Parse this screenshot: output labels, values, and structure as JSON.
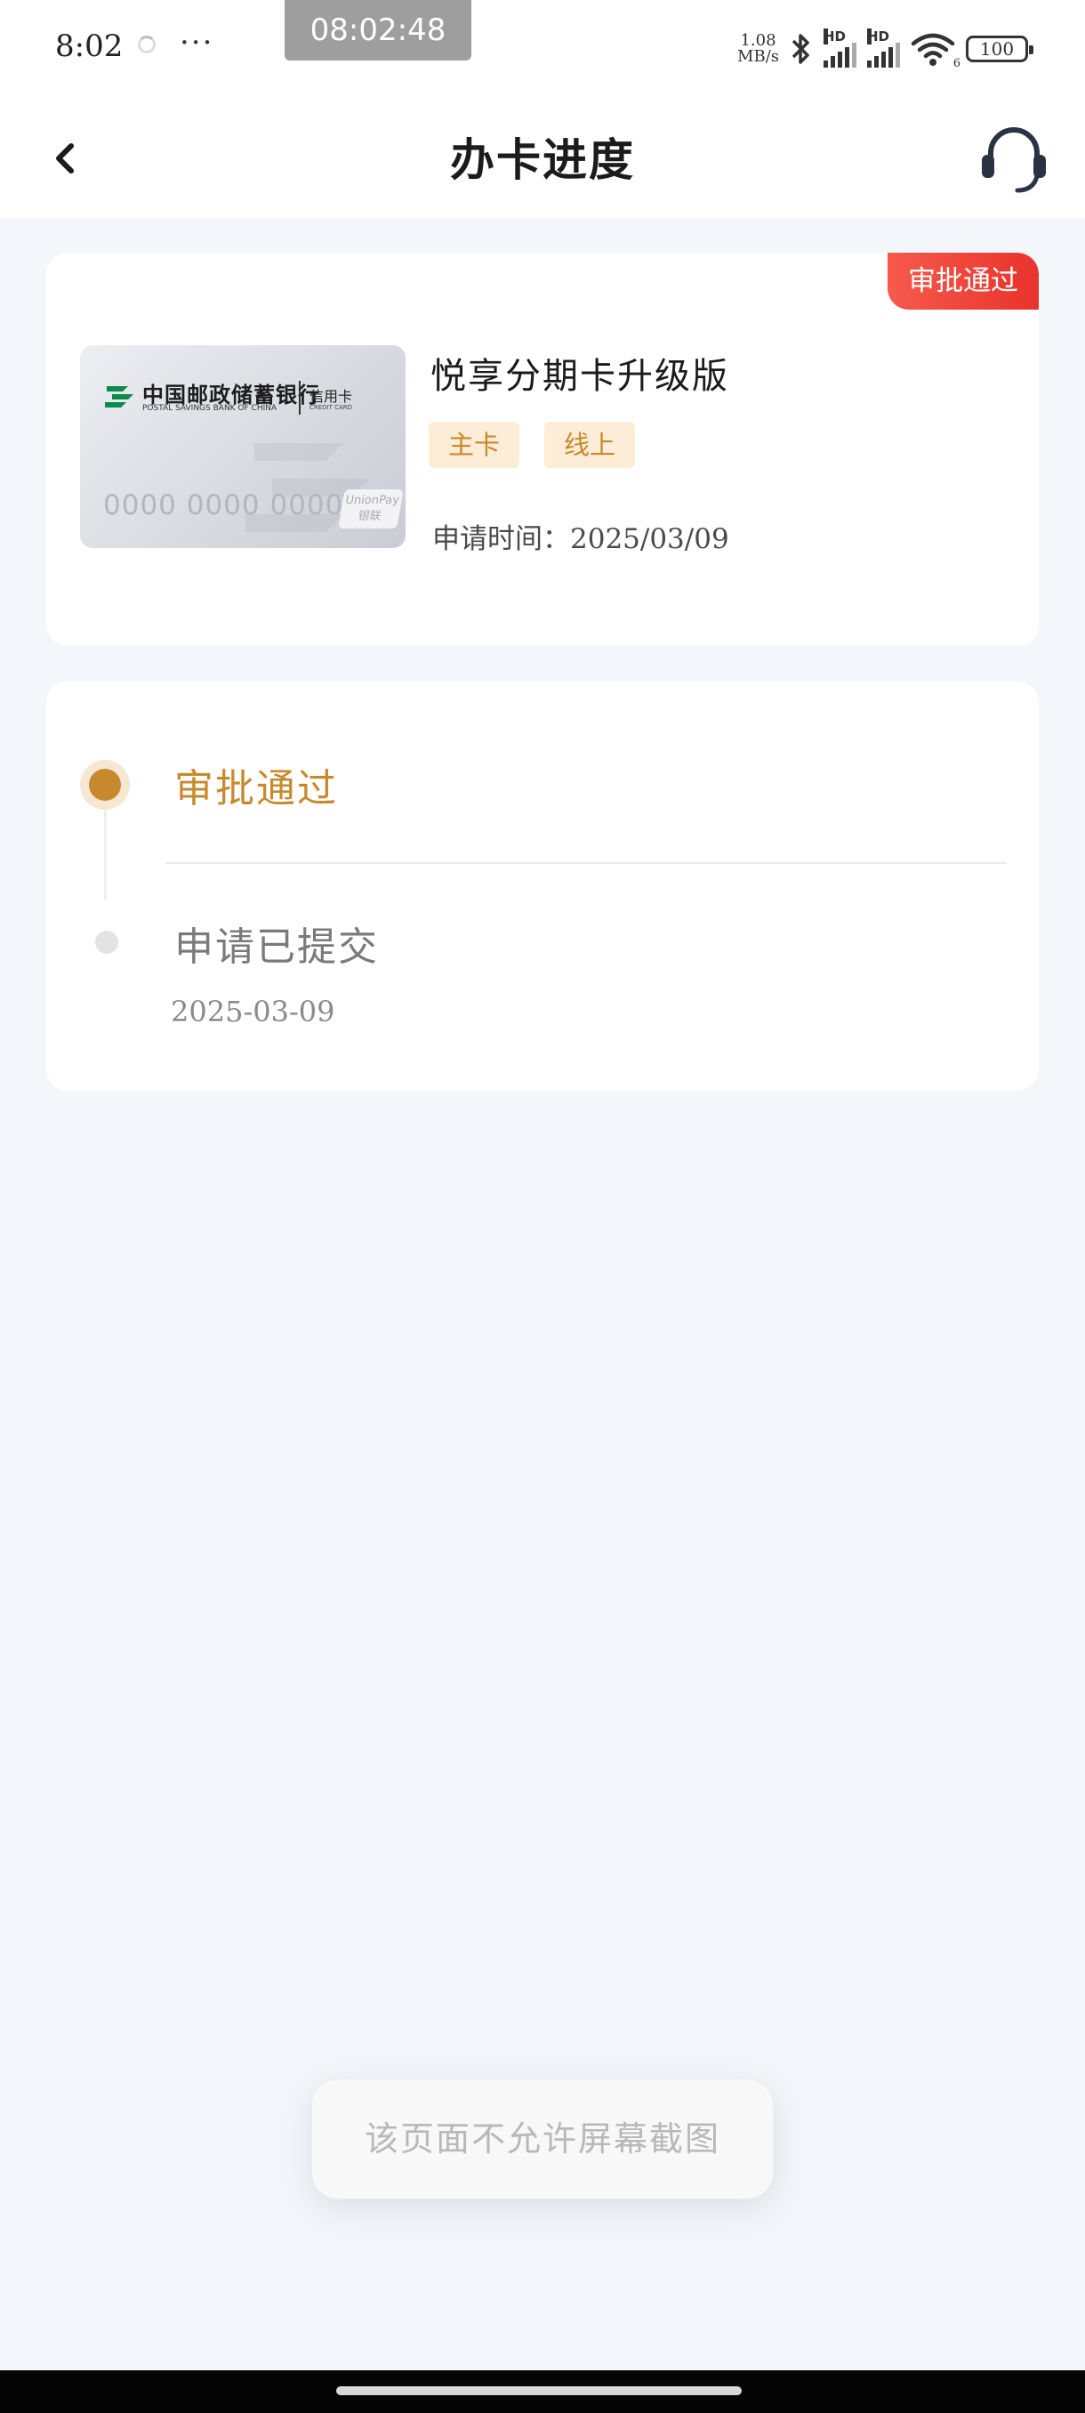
{
  "status_bar": {
    "time": "8:02",
    "more": "···",
    "clock_overlay": "08:02:48",
    "net_speed_value": "1.08",
    "net_speed_unit": "MB/s",
    "signal1_label": "HD",
    "signal2_label": "HD",
    "wifi_label": "6",
    "battery": "100"
  },
  "nav": {
    "title": "办卡进度"
  },
  "card": {
    "status_tag": "审批通过",
    "bank_name_cn": "中国邮政储蓄银行",
    "bank_name_en": "POSTAL SAVINGS BANK OF CHINA",
    "card_kind": "信用卡",
    "card_kind_en": "CREDIT CARD",
    "card_number": "0000 0000 0000",
    "union_pay_en": "UnionPay",
    "union_pay_cn": "银联",
    "product_name": "悦享分期卡升级版",
    "chips": [
      "主卡",
      "线上"
    ],
    "apply_time": "申请时间：2025/03/09"
  },
  "progress": {
    "steps": [
      {
        "title": "审批通过",
        "date": ""
      },
      {
        "title": "申请已提交",
        "date": "2025-03-09"
      }
    ]
  },
  "toast": {
    "message": "该页面不允许屏幕截图"
  },
  "colors": {
    "accent_gold": "#c8892e",
    "tag_red": "#e8332c",
    "chip_bg": "#fdecd6",
    "page_bg": "#f3f6fb"
  },
  "icons": {
    "back": "chevron-left-icon",
    "service": "headset-icon",
    "bluetooth": "bluetooth-icon",
    "wifi": "wifi-icon"
  }
}
